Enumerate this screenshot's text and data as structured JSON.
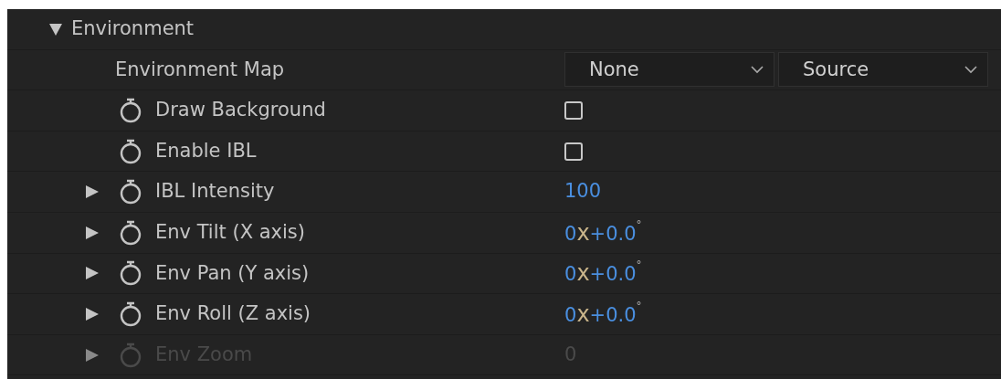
{
  "section": {
    "label": "Environment",
    "expanded": true
  },
  "rows": [
    {
      "kind": "dropdowns",
      "label": "Environment Map",
      "dropdowns": [
        {
          "value": "None"
        },
        {
          "value": "Source"
        }
      ]
    },
    {
      "kind": "checkbox",
      "label": "Draw Background",
      "stopwatch": true,
      "checked": false
    },
    {
      "kind": "checkbox",
      "label": "Enable IBL",
      "stopwatch": true,
      "checked": false
    },
    {
      "kind": "number",
      "label": "IBL Intensity",
      "stopwatch": true,
      "expanded": false,
      "value": "100"
    },
    {
      "kind": "angle",
      "label": "Env Tilt (X axis)",
      "stopwatch": true,
      "expanded": false,
      "revolutions": "0",
      "times": "x",
      "degrees": "+0.0",
      "unit": "°"
    },
    {
      "kind": "angle",
      "label": "Env Pan (Y axis)",
      "stopwatch": true,
      "expanded": false,
      "revolutions": "0",
      "times": "x",
      "degrees": "+0.0",
      "unit": "°"
    },
    {
      "kind": "angle",
      "label": "Env Roll (Z axis)",
      "stopwatch": true,
      "expanded": false,
      "revolutions": "0",
      "times": "x",
      "degrees": "+0.0",
      "unit": "°"
    },
    {
      "kind": "number",
      "label": "Env Zoom",
      "stopwatch": true,
      "expanded": false,
      "disabled": true,
      "value": "0"
    }
  ]
}
